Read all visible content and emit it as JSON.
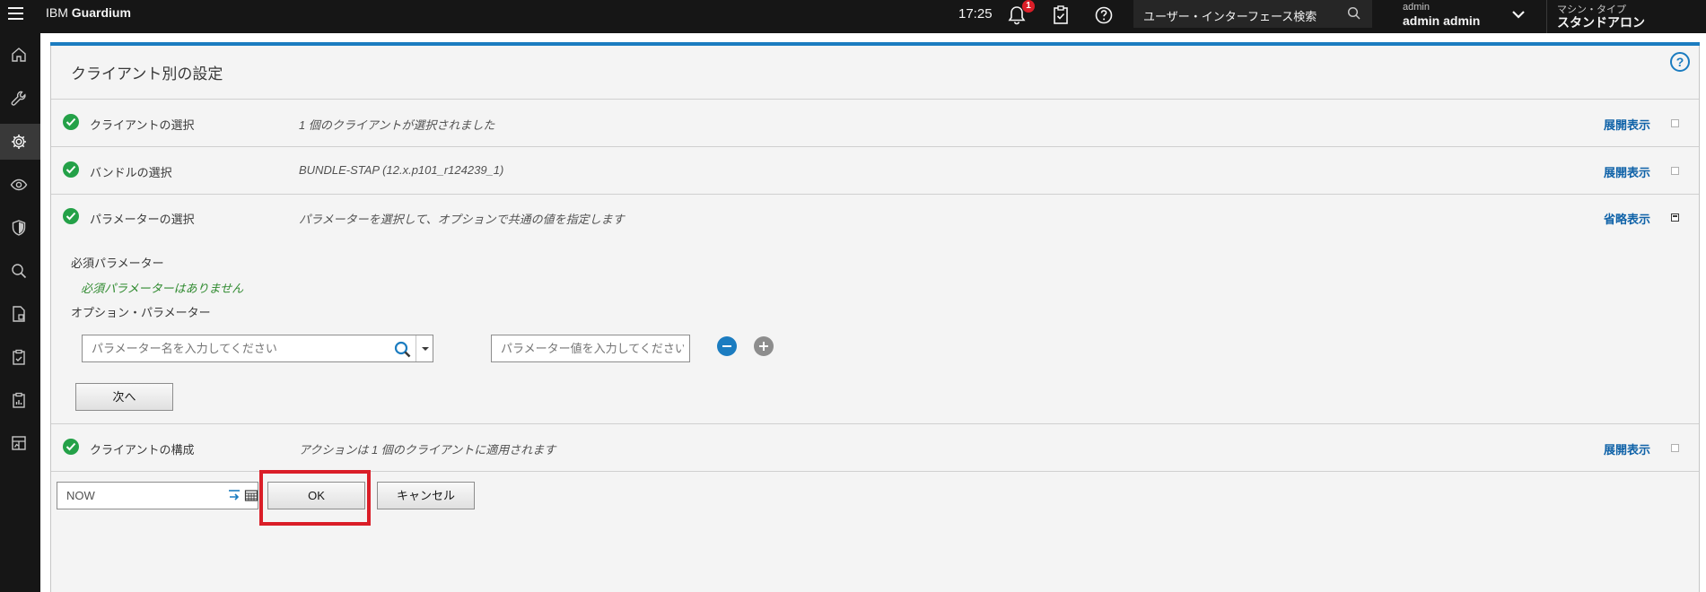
{
  "topbar": {
    "brand_prefix": "IBM",
    "brand_name": "Guardium",
    "time": "17:25",
    "notification_count": "1",
    "search_placeholder": "ユーザー・インターフェース検索",
    "user_label": "admin",
    "user_name": "admin admin",
    "machine_label": "マシン・タイプ",
    "machine_type": "スタンドアロン"
  },
  "sidenav": {
    "items": [
      "home-icon",
      "wrench-icon",
      "gear-icon",
      "eye-icon",
      "shield-icon",
      "search-icon",
      "report-icon",
      "clipboard-icon",
      "audit-icon",
      "dashboard-icon"
    ],
    "active": "gear-icon"
  },
  "page": {
    "title": "クライアント別の設定",
    "help_glyph": "?",
    "accent_color": "#1b7cc0"
  },
  "steps": [
    {
      "label": "クライアントの選択",
      "desc": "1 個のクライアントが選択されました",
      "link": "展開表示"
    },
    {
      "label": "バンドルの選択",
      "desc": "BUNDLE-STAP (12.x.p101_r124239_1)",
      "link": "展開表示"
    },
    {
      "label": "パラメーターの選択",
      "desc": "パラメーターを選択して、オプションで共通の値を指定します",
      "link": "省略表示"
    },
    {
      "label": "クライアントの構成",
      "desc": "アクションは 1 個のクライアントに適用されます",
      "link": "展開表示"
    }
  ],
  "params": {
    "required_heading": "必須パラメーター",
    "required_none": "必須パラメーターはありません",
    "optional_heading": "オプション・パラメーター",
    "name_placeholder": "パラメーター名を入力してください",
    "value_placeholder": "パラメーター値を入力してください",
    "next_button": "次へ"
  },
  "footer": {
    "schedule_value": "NOW",
    "ok_button": "OK",
    "cancel_button": "キャンセル"
  }
}
